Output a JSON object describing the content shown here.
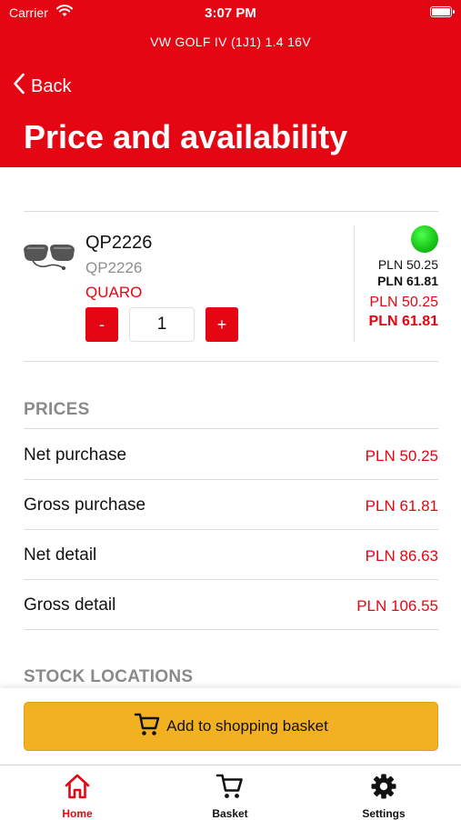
{
  "status_bar": {
    "carrier": "Carrier",
    "time": "3:07 PM"
  },
  "header": {
    "vehicle": "VW GOLF IV (1J1) 1.4 16V",
    "back_label": "Back",
    "title": "Price and availability"
  },
  "product": {
    "name": "QP2226",
    "code": "QP2226",
    "brand": "QUARO",
    "quantity": "1",
    "minus_label": "-",
    "plus_label": "+",
    "availability_color": "#1dd21d",
    "side_net": "PLN 50.25",
    "side_gross": "PLN 61.81",
    "side_net_red": "PLN 50.25",
    "side_gross_red": "PLN 61.81"
  },
  "prices": {
    "section_title": "PRICES",
    "rows": [
      {
        "label": "Net purchase",
        "value": "PLN 50.25"
      },
      {
        "label": "Gross purchase",
        "value": "PLN 61.81"
      },
      {
        "label": "Net detail",
        "value": "PLN 86.63"
      },
      {
        "label": "Gross detail",
        "value": "PLN 106.55"
      }
    ]
  },
  "stock": {
    "section_title": "STOCK LOCATIONS"
  },
  "add_button": {
    "label": "Add to shopping basket",
    "icon": "cart-icon"
  },
  "tabs": [
    {
      "label": "Home",
      "icon": "home-icon",
      "active": true
    },
    {
      "label": "Basket",
      "icon": "cart-icon",
      "active": false
    },
    {
      "label": "Settings",
      "icon": "gear-icon",
      "active": false
    }
  ],
  "colors": {
    "brand_red": "#e40613",
    "button_yellow": "#f2b120",
    "muted_gray": "#8a8a8a"
  }
}
